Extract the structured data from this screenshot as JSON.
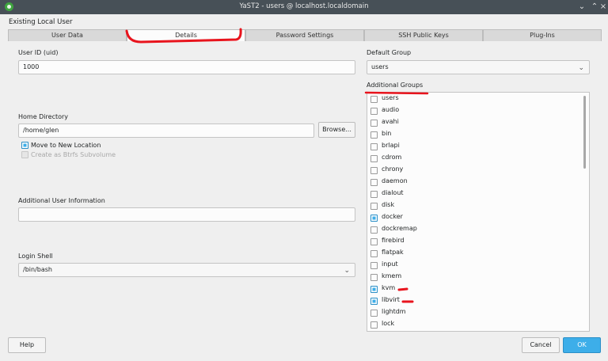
{
  "window": {
    "title": "YaST2 - users @ localhost.localdomain"
  },
  "dialog": {
    "heading": "Existing Local User"
  },
  "tabs": [
    {
      "label": "User Data"
    },
    {
      "label": "Details"
    },
    {
      "label": "Password Settings"
    },
    {
      "label": "SSH Public Keys"
    },
    {
      "label": "Plug-Ins"
    }
  ],
  "details": {
    "uid_label": "User ID (uid)",
    "uid_value": "1000",
    "home_label": "Home Directory",
    "home_value": "/home/glen",
    "browse_label": "Browse...",
    "move_label": "Move to New Location",
    "btrfs_label": "Create as Btrfs Subvolume",
    "info_label": "Additional User Information",
    "info_value": "",
    "shell_label": "Login Shell",
    "shell_value": "/bin/bash",
    "default_group_label": "Default Group",
    "default_group_value": "users",
    "additional_groups_label": "Additional Groups"
  },
  "groups": [
    {
      "name": "users",
      "checked": false
    },
    {
      "name": "audio",
      "checked": false
    },
    {
      "name": "avahi",
      "checked": false
    },
    {
      "name": "bin",
      "checked": false
    },
    {
      "name": "brlapi",
      "checked": false
    },
    {
      "name": "cdrom",
      "checked": false
    },
    {
      "name": "chrony",
      "checked": false
    },
    {
      "name": "daemon",
      "checked": false
    },
    {
      "name": "dialout",
      "checked": false
    },
    {
      "name": "disk",
      "checked": false
    },
    {
      "name": "docker",
      "checked": true
    },
    {
      "name": "dockremap",
      "checked": false
    },
    {
      "name": "firebird",
      "checked": false
    },
    {
      "name": "flatpak",
      "checked": false
    },
    {
      "name": "input",
      "checked": false
    },
    {
      "name": "kmem",
      "checked": false
    },
    {
      "name": "kvm",
      "checked": true
    },
    {
      "name": "libvirt",
      "checked": true
    },
    {
      "name": "lightdm",
      "checked": false
    },
    {
      "name": "lock",
      "checked": false
    }
  ],
  "footer": {
    "help_label": "Help",
    "cancel_label": "Cancel",
    "ok_label": "OK"
  },
  "colors": {
    "accent": "#3daee9",
    "annotation": "#e8141d",
    "titlebar": "#475057"
  }
}
